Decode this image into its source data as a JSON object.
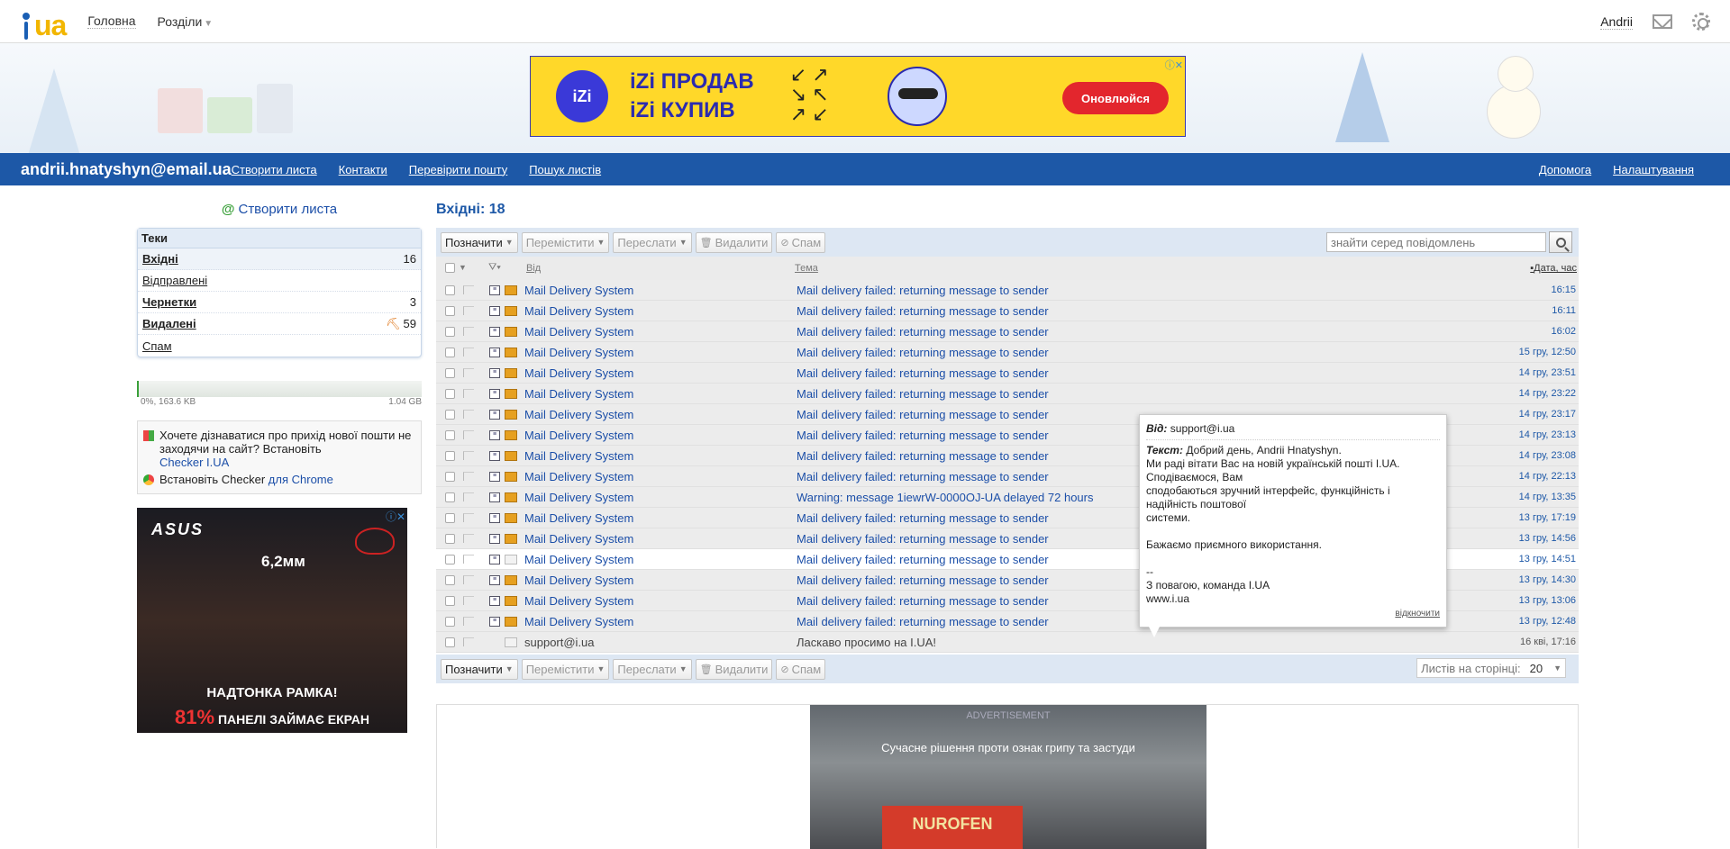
{
  "top": {
    "logo_text": "ua",
    "links": [
      "Головна",
      "Розділи"
    ],
    "user": "Andrii"
  },
  "ad_top": {
    "brand": "iZi",
    "line1": "iZi ПРОДАВ",
    "line2": "iZi КУПИВ",
    "button": "Оновлюйся"
  },
  "nav": {
    "email": "andrii.hnatyshyn@email.ua",
    "links": [
      "Створити листа",
      "Контакти",
      "Перевірити пошту",
      "Пошук листів"
    ],
    "right_links": [
      "Допомога",
      "Налаштування"
    ]
  },
  "sidebar": {
    "create": "Створити листа",
    "folders_title": "Теки",
    "folders": [
      {
        "label": "Вхідні",
        "count": "16"
      },
      {
        "label": "Відправлені",
        "count": ""
      },
      {
        "label": "Чернетки",
        "count": "3"
      },
      {
        "label": "Видалені",
        "count": "59"
      },
      {
        "label": "Спам",
        "count": ""
      }
    ],
    "quota_used": "0%, 163.6 KB",
    "quota_max": "1.04 GB",
    "checker_text": "Хочете дізнаватися про прихід нової пошти не заходячи на сайт? Встановіть",
    "checker_link": "Checker I.UA",
    "chrome_text": "Встановіть Checker",
    "chrome_link": "для Chrome"
  },
  "ad_left": {
    "brand": "ASUS",
    "thickness": "6,2мм",
    "line1": "НАДТОНКА РАМКА!",
    "pct": "81%",
    "line2": "ПАНЕЛІ ЗАЙМАЄ ЕКРАН"
  },
  "inbox": {
    "title": "Вхідні: 18",
    "toolbar": {
      "mark": "Позначити",
      "move": "Перемістити",
      "forward": "Переслати",
      "delete": "Видалити",
      "spam": "Спам"
    },
    "search_placeholder": "знайти серед повідомлень",
    "columns": {
      "from": "Від",
      "subject": "Тема",
      "date": "Дата, час"
    },
    "messages": [
      {
        "from": "Mail Delivery System",
        "subject": "Mail delivery failed: returning message to sender",
        "date": "16:15"
      },
      {
        "from": "Mail Delivery System",
        "subject": "Mail delivery failed: returning message to sender",
        "date": "16:11"
      },
      {
        "from": "Mail Delivery System",
        "subject": "Mail delivery failed: returning message to sender",
        "date": "16:02"
      },
      {
        "from": "Mail Delivery System",
        "subject": "Mail delivery failed: returning message to sender",
        "date": "15 гру, 12:50"
      },
      {
        "from": "Mail Delivery System",
        "subject": "Mail delivery failed: returning message to sender",
        "date": "14 гру, 23:51"
      },
      {
        "from": "Mail Delivery System",
        "subject": "Mail delivery failed: returning message to sender",
        "date": "14 гру, 23:22"
      },
      {
        "from": "Mail Delivery System",
        "subject": "Mail delivery failed: returning message to sender",
        "date": "14 гру, 23:17"
      },
      {
        "from": "Mail Delivery System",
        "subject": "Mail delivery failed: returning message to sender",
        "date": "14 гру, 23:13"
      },
      {
        "from": "Mail Delivery System",
        "subject": "Mail delivery failed: returning message to sender",
        "date": "14 гру, 23:08"
      },
      {
        "from": "Mail Delivery System",
        "subject": "Mail delivery failed: returning message to sender",
        "date": "14 гру, 22:13"
      },
      {
        "from": "Mail Delivery System",
        "subject": "Warning: message 1iewrW-0000OJ-UA delayed 72 hours",
        "date": "14 гру, 13:35"
      },
      {
        "from": "Mail Delivery System",
        "subject": "Mail delivery failed: returning message to sender",
        "date": "13 гру, 17:19"
      },
      {
        "from": "Mail Delivery System",
        "subject": "Mail delivery failed: returning message to sender",
        "date": "13 гру, 14:56"
      },
      {
        "from": "Mail Delivery System",
        "subject": "Mail delivery failed: returning message to sender",
        "date": "13 гру, 14:51"
      },
      {
        "from": "Mail Delivery System",
        "subject": "Mail delivery failed: returning message to sender",
        "date": "13 гру, 14:30"
      },
      {
        "from": "Mail Delivery System",
        "subject": "Mail delivery failed: returning message to sender",
        "date": "13 гру, 13:06"
      },
      {
        "from": "Mail Delivery System",
        "subject": "Mail delivery failed: returning message to sender",
        "date": "13 гру, 12:48"
      },
      {
        "from": "support@i.ua",
        "subject": "Ласкаво просимо на I.UA!",
        "date": "16 кві, 17:16"
      }
    ],
    "per_page_label": "Листів на сторінці:",
    "per_page_value": "20"
  },
  "tooltip": {
    "from_label": "Від:",
    "from": "support@i.ua",
    "text_label": "Текст:",
    "lines": [
      "Добрий день, Andrii Hnatyshyn.",
      "Ми раді вітати Вас на новій українській пошті I.UA.",
      "Сподіваємося, Вам",
      "сподобаються зручний інтерфейс, функційність і",
      "надійність поштової",
      "системи.",
      "",
      "Бажаємо приємного використання.",
      "",
      "--",
      "З повагою, команда I.UA",
      "www.i.ua"
    ],
    "close": "відкночити"
  },
  "ad_bottom": {
    "label": "ADVERTISEMENT",
    "text": "Сучасне рішення проти ознак грипу та застуди",
    "product": "NUROFEN"
  },
  "colors": {
    "nav_blue": "#1d58a7",
    "link": "#1c4fa8",
    "logo_yellow": "#f2b600"
  }
}
